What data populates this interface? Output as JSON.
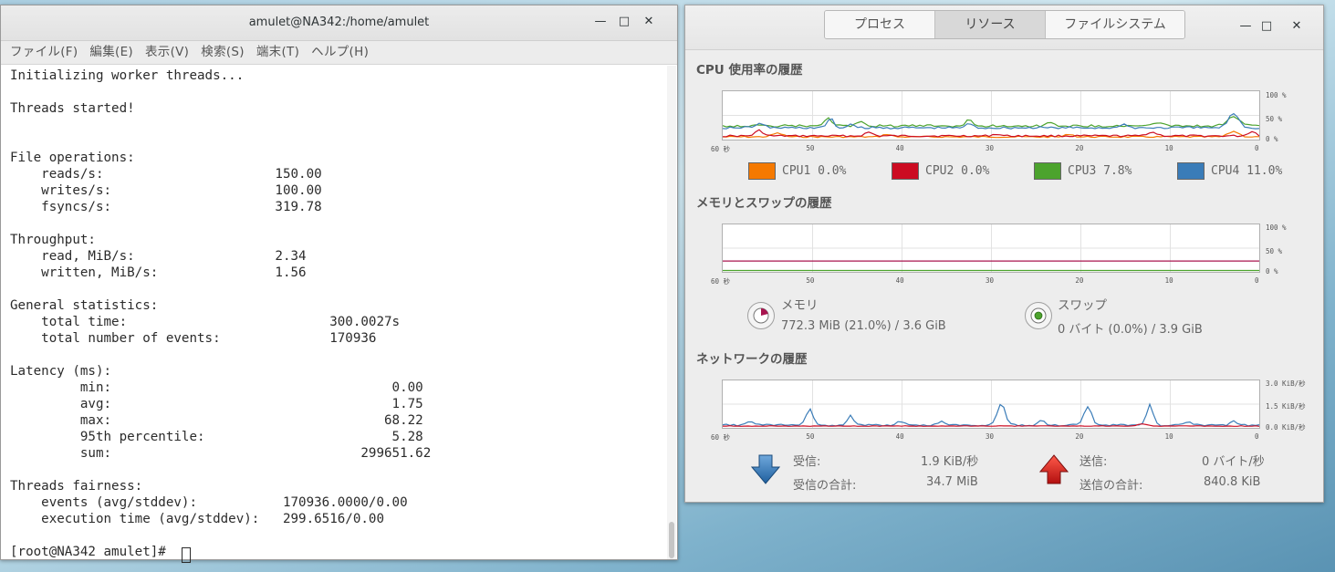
{
  "terminal": {
    "title": "amulet@NA342:/home/amulet",
    "menu": [
      "ファイル(F)",
      "編集(E)",
      "表示(V)",
      "検索(S)",
      "端末(T)",
      "ヘルプ(H)"
    ],
    "lines": [
      "Initializing worker threads...",
      "",
      "Threads started!",
      "",
      "",
      "File operations:",
      "    reads/s:                      150.00",
      "    writes/s:                     100.00",
      "    fsyncs/s:                     319.78",
      "",
      "Throughput:",
      "    read, MiB/s:                  2.34",
      "    written, MiB/s:               1.56",
      "",
      "General statistics:",
      "    total time:                          300.0027s",
      "    total number of events:              170936",
      "",
      "Latency (ms):",
      "         min:                                    0.00",
      "         avg:                                    1.75",
      "         max:                                   68.22",
      "         95th percentile:                        5.28",
      "         sum:                                299651.62",
      "",
      "Threads fairness:",
      "    events (avg/stddev):           170936.0000/0.00",
      "    execution time (avg/stddev):   299.6516/0.00",
      "",
      "[root@NA342 amulet]# "
    ]
  },
  "monitor": {
    "tabs": [
      "プロセス",
      "リソース",
      "ファイルシステム"
    ],
    "active_tab": 1,
    "cpu": {
      "title": "CPU 使用率の履歴",
      "y_labels": [
        "100 %",
        "50 %",
        "0 %"
      ],
      "x_labels": [
        "60 秒",
        "50",
        "40",
        "30",
        "20",
        "10",
        "0"
      ],
      "legend": [
        {
          "label": "CPU1 0.0%",
          "color": "#f57900"
        },
        {
          "label": "CPU2 0.0%",
          "color": "#cc0c22"
        },
        {
          "label": "CPU3 7.8%",
          "color": "#4ca32d"
        },
        {
          "label": "CPU4 11.0%",
          "color": "#3a7cb8"
        }
      ]
    },
    "memory": {
      "title": "メモリとスワップの履歴",
      "y_labels": [
        "100 %",
        "50 %",
        "0 %"
      ],
      "x_labels": [
        "60 秒",
        "50",
        "40",
        "30",
        "20",
        "10",
        "0"
      ],
      "mem_label": "メモリ",
      "mem_value": "772.3 MiB (21.0%) / 3.6 GiB",
      "mem_percent": 21.0,
      "mem_color": "#a8154f",
      "swap_label": "スワップ",
      "swap_value": "0 バイト (0.0%) / 3.9 GiB",
      "swap_percent": 0.0,
      "swap_color": "#4ca32d"
    },
    "network": {
      "title": "ネットワークの履歴",
      "y_labels": [
        "3.0 KiB/秒",
        "1.5 KiB/秒",
        "0.0 KiB/秒"
      ],
      "x_labels": [
        "60 秒",
        "50",
        "40",
        "30",
        "20",
        "10",
        "0"
      ],
      "recv_label": "受信:",
      "recv_value": "1.9 KiB/秒",
      "recv_total_label": "受信の合計:",
      "recv_total_value": "34.7 MiB",
      "send_label": "送信:",
      "send_value": "0 バイト/秒",
      "send_total_label": "送信の合計:",
      "send_total_value": "840.8 KiB",
      "recv_color": "#3a7cb8",
      "send_color": "#cc0c22"
    }
  }
}
